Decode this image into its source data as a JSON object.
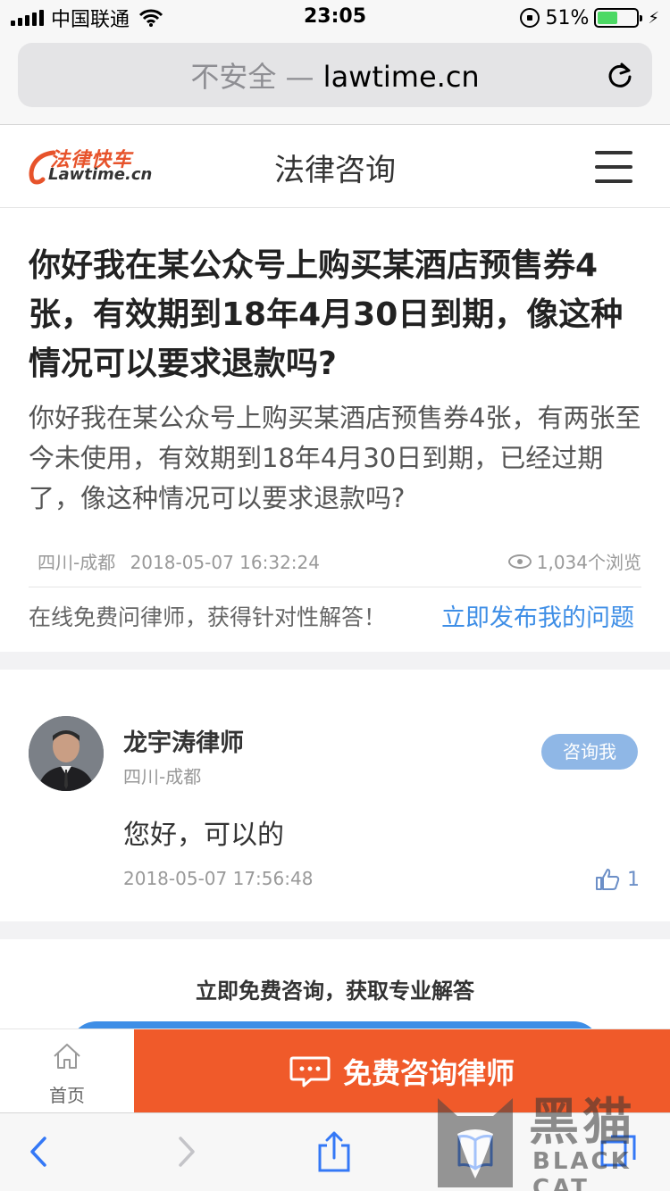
{
  "status_bar": {
    "carrier": "中国联通",
    "time": "23:05",
    "battery": "51%",
    "battery_level": 0.51
  },
  "browser": {
    "security": "不安全 —",
    "domain": "lawtime.cn"
  },
  "site_header": {
    "logo_cn": "法律快车",
    "logo_en": "Lawtime.cn",
    "title": "法律咨询"
  },
  "question": {
    "title": "你好我在某公众号上购买某酒店预售券4张，有效期到18年4月30日到期，像这种情况可以要求退款吗?",
    "body": "你好我在某公众号上购买某酒店预售券4张，有两张至今未使用，有效期到18年4月30日到期，已经过期了，像这种情况可以要求退款吗?",
    "location": "四川-成都",
    "datetime": "2018-05-07 16:32:24",
    "views": "1,034个浏览",
    "cta_text": "在线免费问律师，获得针对性解答！",
    "cta_link": "立即发布我的问题"
  },
  "answer": {
    "lawyer_name": "龙宇涛律师",
    "lawyer_location": "四川-成都",
    "consult_label": "咨询我",
    "text": "您好，可以的",
    "datetime": "2018-05-07 17:56:48",
    "likes": "1"
  },
  "promo": {
    "title": "立即免费咨询，获取专业解答"
  },
  "action_bar": {
    "home_label": "首页",
    "consult_label": "免费咨询律师"
  },
  "watermark": {
    "cn": "黑猫",
    "en": "BLACK CAT"
  },
  "colors": {
    "accent_blue": "#3e8ee6",
    "accent_orange": "#f05a2a",
    "consult_btn": "#8fb7e6"
  },
  "icons": [
    "signal-icon",
    "wifi-icon",
    "rotation-lock-icon",
    "battery-icon",
    "reload-icon",
    "menu-icon",
    "eye-icon",
    "thumb-up-icon",
    "home-icon",
    "chat-icon",
    "back-icon",
    "forward-icon",
    "share-icon",
    "bookmarks-icon",
    "tabs-icon"
  ]
}
